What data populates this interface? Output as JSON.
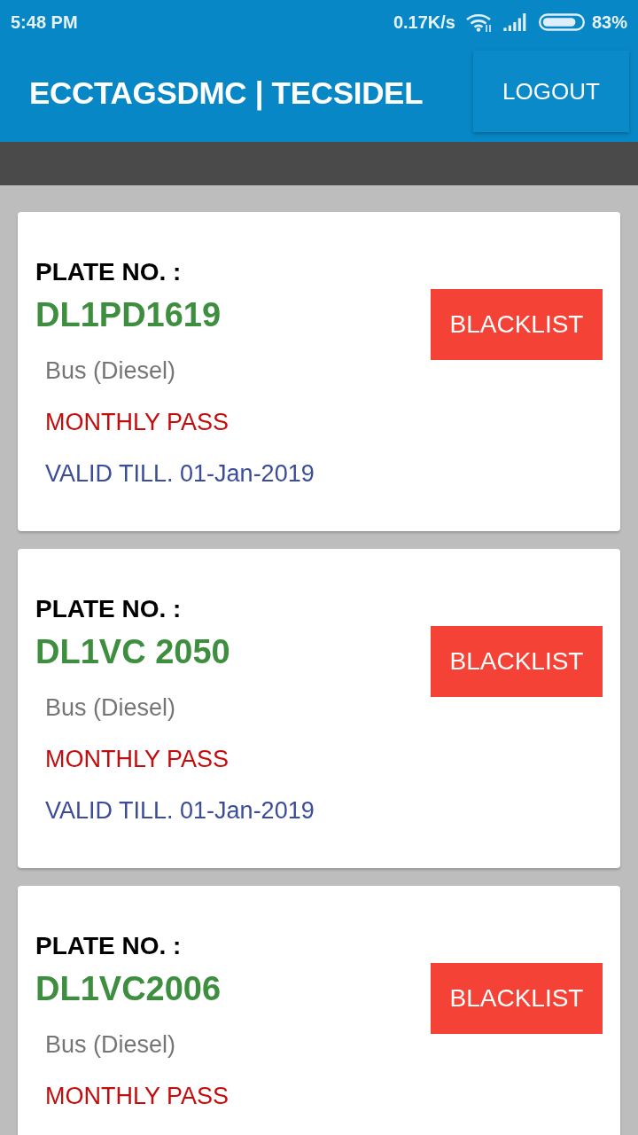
{
  "status_bar": {
    "time": "5:48 PM",
    "network_speed": "0.17K/s",
    "battery": "83%"
  },
  "app_bar": {
    "title": "ECCTAGSDMC | TECSIDEL",
    "logout_button": "LOGOUT"
  },
  "vehicles": [
    {
      "plate_label": "PLATE NO. :",
      "plate": "DL1PD1619",
      "vehicle_type": "Bus (Diesel)",
      "pass_type": "MONTHLY PASS",
      "valid_till": "VALID TILL. 01-Jan-2019",
      "action": "BLACKLIST"
    },
    {
      "plate_label": "PLATE NO. :",
      "plate": "DL1VC 2050",
      "vehicle_type": "Bus (Diesel)",
      "pass_type": "MONTHLY PASS",
      "valid_till": "VALID TILL. 01-Jan-2019",
      "action": "BLACKLIST"
    },
    {
      "plate_label": "PLATE NO. :",
      "plate": "DL1VC2006",
      "vehicle_type": "Bus (Diesel)",
      "pass_type": "MONTHLY PASS",
      "action": "BLACKLIST"
    }
  ]
}
